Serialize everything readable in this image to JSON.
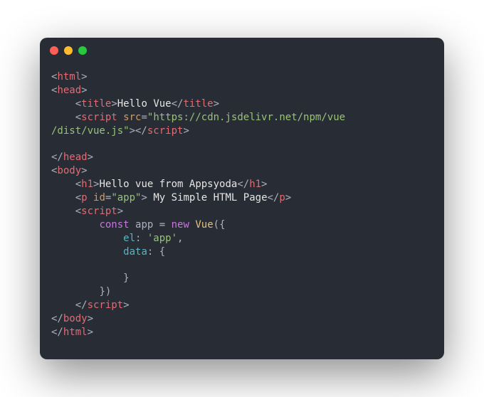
{
  "code": {
    "l1_open_html": "html",
    "l2_open_head": "head",
    "l3_title_open": "title",
    "l3_title_text": "Hello Vue",
    "l3_title_close": "title",
    "l4_script_tag": "script",
    "l4_src_attr": "src",
    "l4_src_val_a": "\"https://cdn.jsdelivr.net/npm/vue",
    "l4_src_val_b": "/dist/vue.js\"",
    "l6_close_head": "head",
    "l7_open_body": "body",
    "l8_h1_open": "h1",
    "l8_h1_text": "Hello vue from Appsyoda",
    "l8_h1_close": "h1",
    "l9_p_open": "p",
    "l9_id_attr": "id",
    "l9_id_val": "\"app\"",
    "l9_p_text": " My Simple HTML Page",
    "l9_p_close": "p",
    "l10_script_open": "script",
    "l11_const": "const",
    "l11_app": " app = ",
    "l11_new": "new",
    "l11_vue": "Vue",
    "l11_paren": "({",
    "l12_el": "el",
    "l12_el_val": "'app'",
    "l12_colon": ": ",
    "l12_comma": ",",
    "l13_data": "data",
    "l13_colon_brace": ": {",
    "l15_close_brace": "}",
    "l16_close_paren": "})",
    "l17_script_close": "script",
    "l18_close_body": "body",
    "l19_close_html": "html"
  }
}
